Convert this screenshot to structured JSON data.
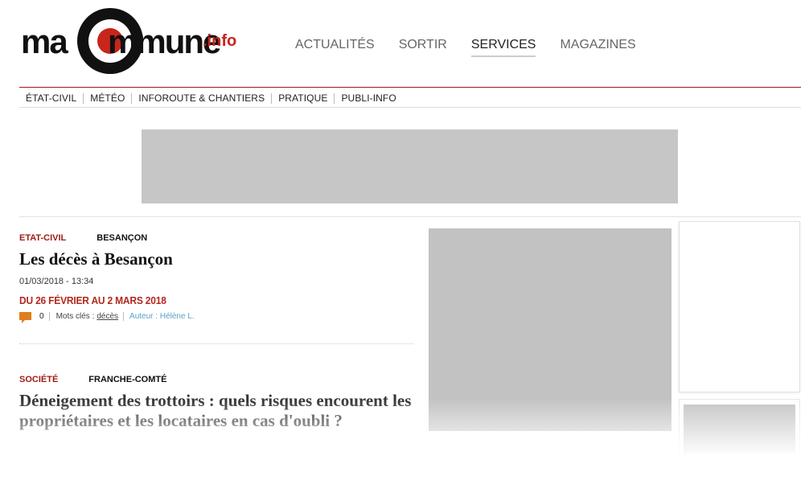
{
  "header": {
    "logo": {
      "part1": "ma",
      "part2": "mmune",
      "suffix": ".info"
    },
    "nav": [
      {
        "label": "ACTUALITÉS",
        "active": false
      },
      {
        "label": "SORTIR",
        "active": false
      },
      {
        "label": "SERVICES",
        "active": true
      },
      {
        "label": "MAGAZINES",
        "active": false
      }
    ]
  },
  "subnav": [
    {
      "label": "ÉTAT-CIVIL"
    },
    {
      "label": "MÉTÉO"
    },
    {
      "label": "INFOROUTE & CHANTIERS"
    },
    {
      "label": "PRATIQUE"
    },
    {
      "label": "PUBLI-INFO"
    }
  ],
  "articles": [
    {
      "category": "ETAT-CIVIL",
      "location": "BESANÇON",
      "title": "Les décès à Besançon",
      "date": "01/03/2018 - 13:34",
      "summary": "DU 26 FÉVRIER AU 2 MARS 2018",
      "comments": "0",
      "keywords_label": "Mots clés :",
      "keyword": "décès",
      "author": "Auteur : Hélène L."
    },
    {
      "category": "SOCIÉTÉ",
      "location": "FRANCHE-COMTÉ",
      "title": "Déneigement des trottoirs : quels risques encourent les propriétaires et les locataires en cas d'oubli ?"
    }
  ],
  "colors": {
    "brand_red": "#c8251b",
    "category_red": "#9b1b14",
    "comment_orange": "#e07d1f",
    "author_blue": "#5aa0c8"
  },
  "icons": {
    "comment": "speech-bubble-icon"
  }
}
